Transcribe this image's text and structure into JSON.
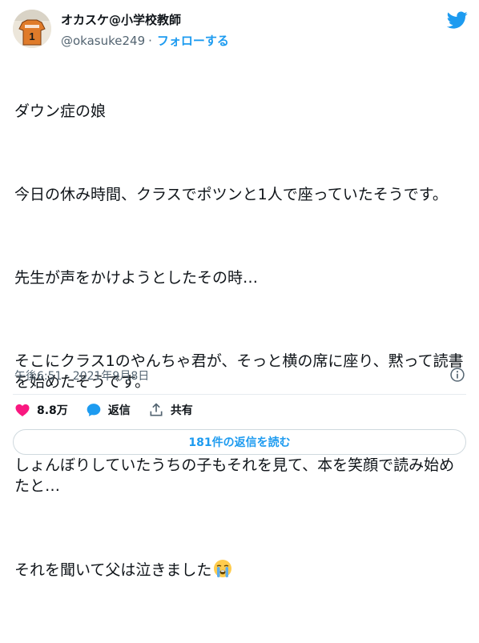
{
  "user": {
    "display_name": "オカスケ@小学校教師",
    "handle": "@okasuke249",
    "separator": "·",
    "follow_label": "フォローする",
    "avatar_shirt_number": "1"
  },
  "tweet": {
    "paragraphs": [
      "ダウン症の娘",
      "今日の休み時間、クラスでポツンと1人で座っていたそうです。",
      "先生が声をかけようとしたその時…",
      "そこにクラス1のやんちゃ君が、そっと横の席に座り、黙って読書を始めたそうです。",
      "しょんぼりしていたうちの子もそれを見て、本を笑顔で読み始めたと…"
    ],
    "last_line": "それを聞いて父は泣きました",
    "last_line_emoji": "loudly-crying-face-emoji"
  },
  "meta": {
    "timestamp": "午後6:51 · 2021年9月8日"
  },
  "actions": {
    "likes_count": "8.8万",
    "reply_label": "返信",
    "share_label": "共有"
  },
  "replies_button": {
    "label": "181件の返信を読む"
  },
  "colors": {
    "accent": "#1d9bf0",
    "like": "#f91880",
    "muted": "#536471",
    "text": "#0f1419"
  }
}
